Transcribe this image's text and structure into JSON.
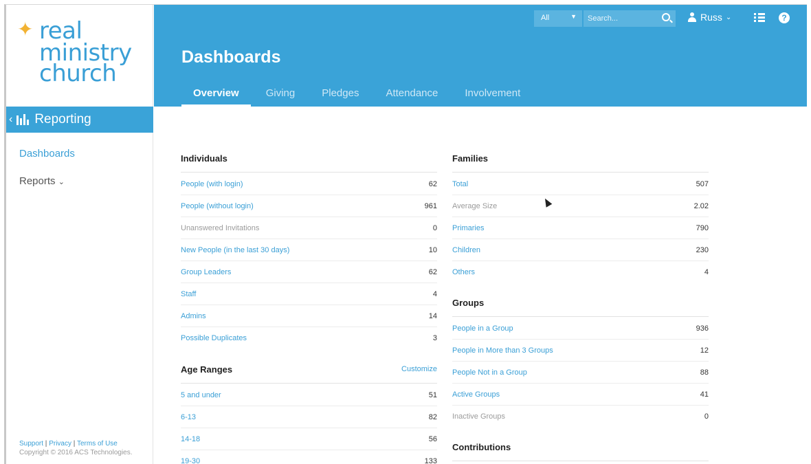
{
  "logo": {
    "line1": "real",
    "line2": "ministry",
    "line3": "church"
  },
  "sidebar": {
    "section": "Reporting",
    "items": [
      {
        "label": "Dashboards"
      },
      {
        "label": "Reports"
      }
    ],
    "footer": {
      "support": "Support",
      "privacy": "Privacy",
      "terms": "Terms of Use",
      "copyright": "Copyright © 2016 ACS Technologies."
    }
  },
  "topbar": {
    "scope_select": "All",
    "search_placeholder": "Search...",
    "user": "Russ"
  },
  "header": {
    "title": "Dashboards",
    "tabs": [
      {
        "label": "Overview",
        "active": true
      },
      {
        "label": "Giving"
      },
      {
        "label": "Pledges"
      },
      {
        "label": "Attendance"
      },
      {
        "label": "Involvement"
      }
    ]
  },
  "individuals": {
    "title": "Individuals",
    "rows": [
      {
        "label": "People (with login)",
        "value": "62"
      },
      {
        "label": "People (without login)",
        "value": "961"
      },
      {
        "label": "Unanswered Invitations",
        "value": "0"
      },
      {
        "label": "New People (in the last 30 days)",
        "value": "10"
      },
      {
        "label": "Group Leaders",
        "value": "62"
      },
      {
        "label": "Staff",
        "value": "4"
      },
      {
        "label": "Admins",
        "value": "14"
      },
      {
        "label": "Possible Duplicates",
        "value": "3"
      }
    ]
  },
  "age_ranges": {
    "title": "Age Ranges",
    "action": "Customize",
    "rows": [
      {
        "label": "5 and under",
        "value": "51"
      },
      {
        "label": "6-13",
        "value": "82"
      },
      {
        "label": "14-18",
        "value": "56"
      },
      {
        "label": "19-30",
        "value": "133"
      }
    ]
  },
  "families": {
    "title": "Families",
    "rows": [
      {
        "label": "Total",
        "value": "507"
      },
      {
        "label": "Average Size",
        "value": "2.02"
      },
      {
        "label": "Primaries",
        "value": "790"
      },
      {
        "label": "Children",
        "value": "230"
      },
      {
        "label": "Others",
        "value": "4"
      }
    ]
  },
  "groups": {
    "title": "Groups",
    "rows": [
      {
        "label": "People in a Group",
        "value": "936"
      },
      {
        "label": "People in More than 3 Groups",
        "value": "12"
      },
      {
        "label": "People Not in a Group",
        "value": "88"
      },
      {
        "label": "Active Groups",
        "value": "41"
      },
      {
        "label": "Inactive Groups",
        "value": "0"
      }
    ]
  },
  "contributions": {
    "title": "Contributions"
  },
  "colors": {
    "brand_blue": "#3aa3d8",
    "logo_star": "#f2b233",
    "link": "#3a9fd6"
  }
}
